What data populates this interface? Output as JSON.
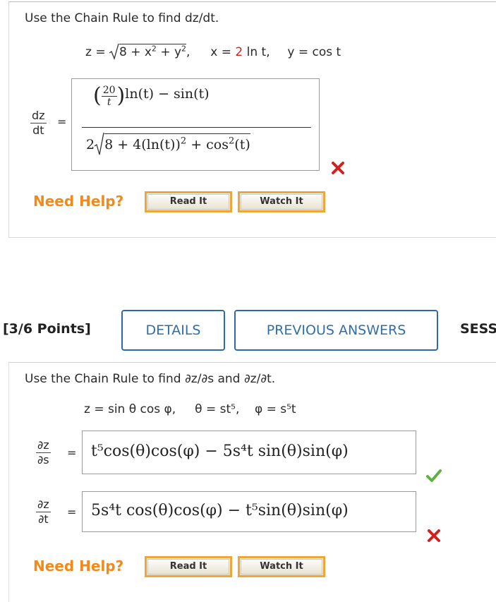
{
  "question1": {
    "prompt": "Use the Chain Rule to find dz/dt.",
    "given": {
      "z_lhs": "z =",
      "z_radicand": "8 + x",
      "x_def_prefix": "x =",
      "x_def_value": "2",
      "x_def_suffix": "ln t,",
      "y_def": "y = cos t"
    },
    "derivative_label": {
      "num": "dz",
      "den": "dt"
    },
    "answer": {
      "frac_coef_num": "20",
      "frac_coef_den": "t",
      "num_rest": "ln(t) − sin(t)",
      "den_coef": "2",
      "den_radicand": "8 + 4(ln(t))",
      "den_rest": "+ cos",
      "den_tail": "(t)",
      "exp": "2"
    },
    "status": "incorrect",
    "help": {
      "label": "Need Help?",
      "read_it": "Read It",
      "watch_it": "Watch It"
    }
  },
  "header": {
    "points": "[3/6 Points]",
    "details_label": "DETAILS",
    "previous_answers_label": "PREVIOUS ANSWERS",
    "session_label": "SESS"
  },
  "question2": {
    "prompt": "Use the Chain Rule to find ∂z/∂s and ∂z/∂t.",
    "given": "z = sin θ cos φ,     θ = st⁵,    φ = s⁵t",
    "derivative_s_label": {
      "num": "∂z",
      "den": "∂s"
    },
    "derivative_t_label": {
      "num": "∂z",
      "den": "∂t"
    },
    "answer_s": "t⁵cos(θ)cos(φ) − 5s⁴t sin(θ)sin(φ)",
    "answer_s_status": "correct",
    "answer_t": "5s⁴t cos(θ)cos(φ) − t⁵sin(θ)sin(φ)",
    "answer_t_status": "incorrect",
    "help": {
      "label": "Need Help?",
      "read_it": "Read It",
      "watch_it": "Watch It"
    }
  },
  "colors": {
    "accent_blue": "#2d6aa5",
    "help_orange": "#f08a1a",
    "button_border": "#f0a636",
    "incorrect_red": "#d31f1f",
    "correct_green": "#5cb23a"
  }
}
